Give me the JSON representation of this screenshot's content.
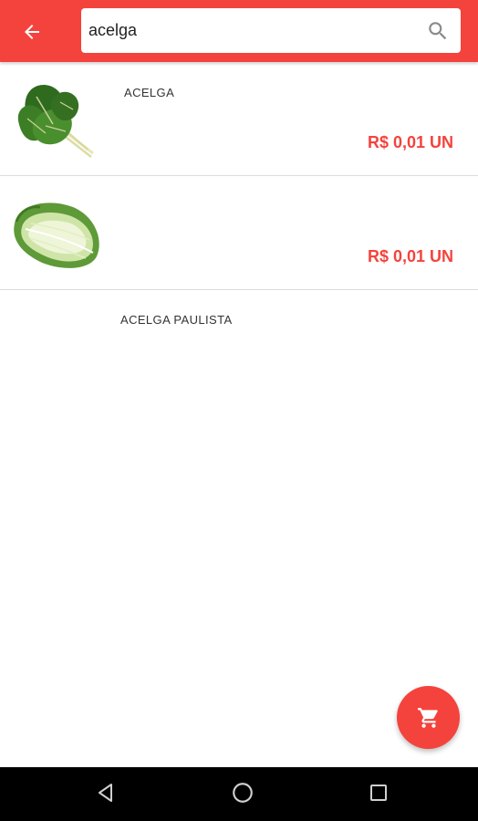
{
  "colors": {
    "accent": "#f4433c",
    "price": "#f4433c",
    "navbar": "#000000"
  },
  "appbar": {
    "back_icon": "arrow-left-icon",
    "search": {
      "value": "acelga",
      "icon": "search-icon"
    }
  },
  "products": [
    {
      "name": "ACELGA",
      "price": "R$ 0,01 UN",
      "image": "swiss-chard-leaves"
    },
    {
      "name": "ACELGA PAULISTA",
      "price": "R$ 0,01 UN",
      "image": "napa-cabbage"
    }
  ],
  "fab": {
    "icon": "shopping-cart-icon"
  },
  "system_nav": {
    "back_icon": "nav-back-triangle-icon",
    "home_icon": "nav-home-circle-icon",
    "recents_icon": "nav-recents-square-icon"
  }
}
